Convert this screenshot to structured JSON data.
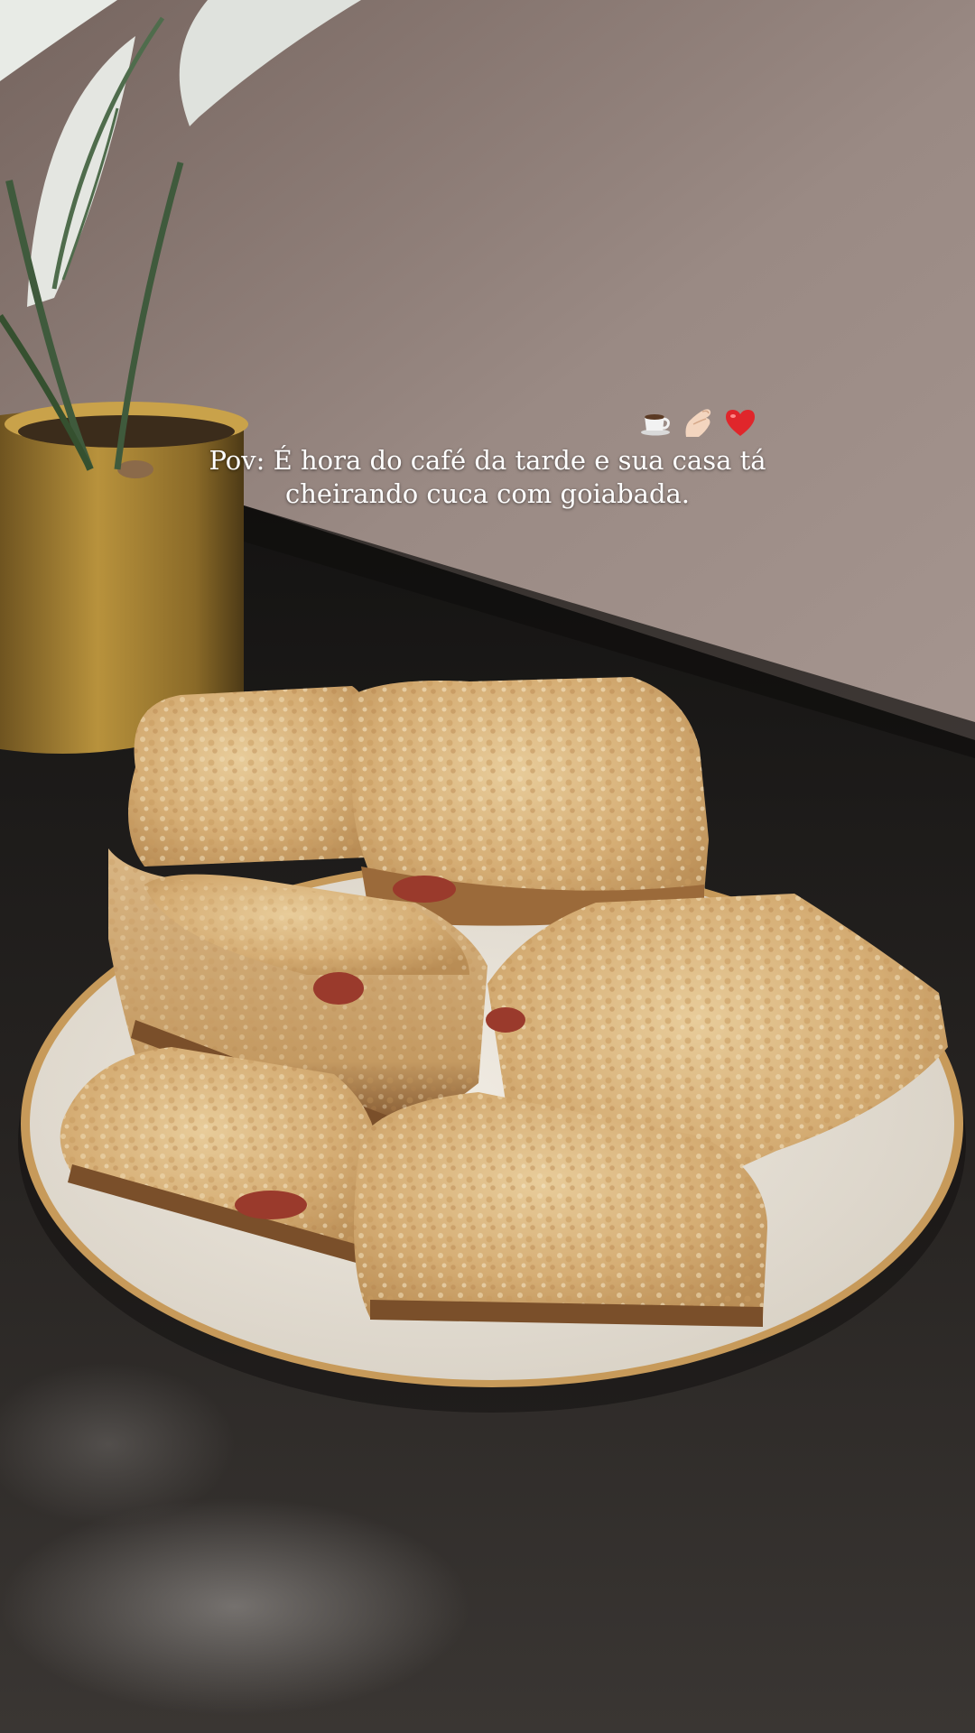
{
  "story": {
    "emojis": [
      "coffee-icon",
      "pinched-fingers-icon",
      "red-heart-icon"
    ],
    "caption_line1": "Pov: É hora do café da tarde e sua casa tá",
    "caption_line2": "cheirando cuca com goiabada."
  },
  "colors": {
    "wall": "#8f7e78",
    "countertop": "#1c1a19",
    "plate": "#e8e2d8",
    "plate_rim": "#c79a5a",
    "crumble": "#d8b27c",
    "guava": "#9a3a2c",
    "pot": "#b58e3a"
  }
}
